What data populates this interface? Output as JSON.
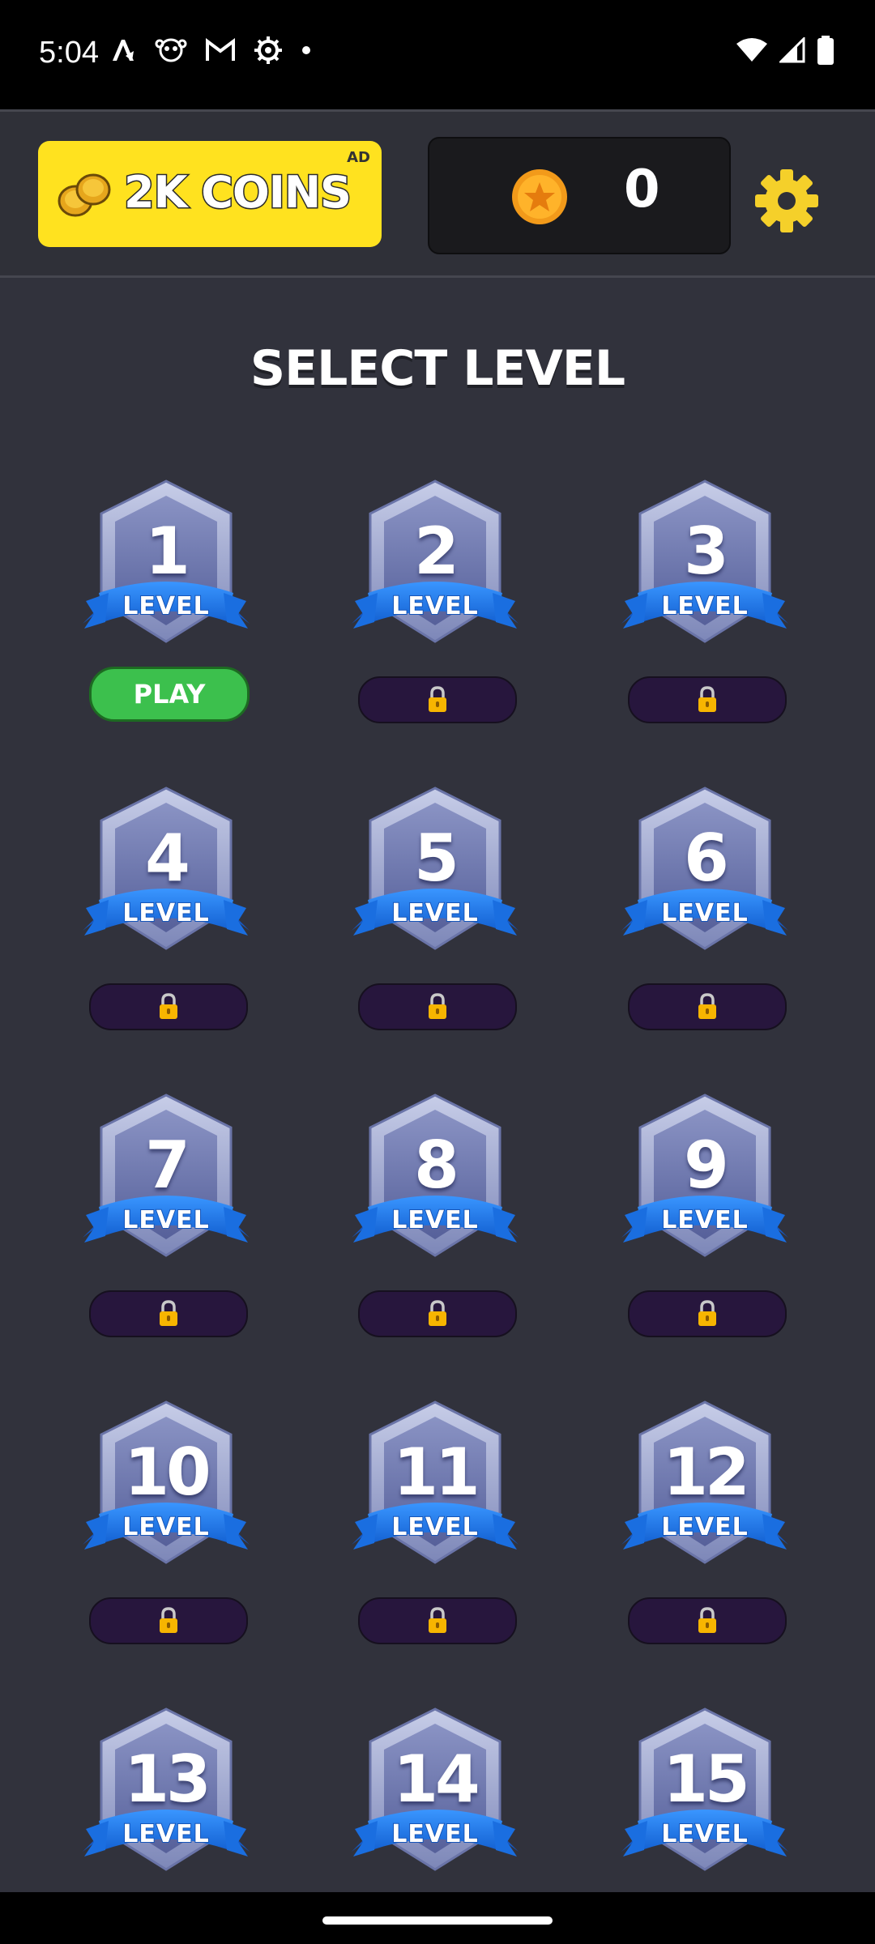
{
  "status_bar": {
    "time": "5:04",
    "left_icons": [
      "text-app-icon",
      "creature-icon",
      "gmail-icon",
      "settings-gear-icon",
      "dot-icon"
    ],
    "right_icons": [
      "wifi-icon",
      "signal-icon",
      "battery-icon"
    ]
  },
  "header": {
    "ad_button": {
      "label": "2K COINS",
      "tag": "AD"
    },
    "coin_balance": "0"
  },
  "title": "SELECT LEVEL",
  "level_word": "LEVEL",
  "play_label": "PLAY",
  "levels": [
    {
      "number": "1",
      "status": "play"
    },
    {
      "number": "2",
      "status": "locked"
    },
    {
      "number": "3",
      "status": "locked"
    },
    {
      "number": "4",
      "status": "locked"
    },
    {
      "number": "5",
      "status": "locked"
    },
    {
      "number": "6",
      "status": "locked"
    },
    {
      "number": "7",
      "status": "locked"
    },
    {
      "number": "8",
      "status": "locked"
    },
    {
      "number": "9",
      "status": "locked"
    },
    {
      "number": "10",
      "status": "locked"
    },
    {
      "number": "11",
      "status": "locked"
    },
    {
      "number": "12",
      "status": "locked"
    },
    {
      "number": "13",
      "status": "locked"
    },
    {
      "number": "14",
      "status": "locked"
    },
    {
      "number": "15",
      "status": "locked"
    }
  ],
  "colors": {
    "background": "#31323c",
    "ad_yellow": "#ffe21f",
    "play_green": "#3cc04d",
    "ribbon_blue": "#1f7ae8",
    "lock_pill": "#27163d",
    "gear_yellow": "#f5d02a"
  }
}
